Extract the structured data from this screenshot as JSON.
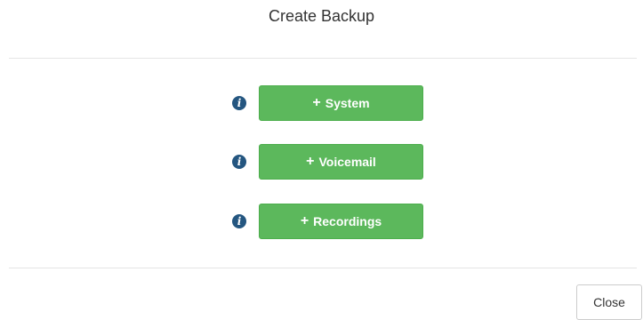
{
  "dialog": {
    "title": "Create Backup"
  },
  "backups": [
    {
      "label": "System",
      "icon": "plus-icon",
      "info_icon": "info-icon"
    },
    {
      "label": "Voicemail",
      "icon": "plus-icon",
      "info_icon": "info-icon"
    },
    {
      "label": "Recordings",
      "icon": "plus-icon",
      "info_icon": "info-icon"
    }
  ],
  "footer": {
    "close_label": "Close"
  },
  "colors": {
    "button_green": "#5cb85c",
    "info_icon_blue": "#245680",
    "divider": "#e5e5e5"
  }
}
